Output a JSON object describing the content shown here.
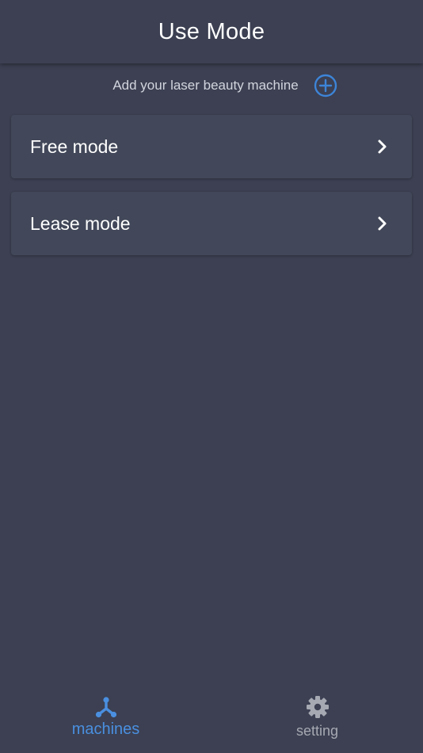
{
  "header": {
    "title": "Use Mode"
  },
  "add_machine": {
    "label": "Add your laser beauty machine",
    "icon": "plus-circle-icon"
  },
  "modes": [
    {
      "label": "Free mode",
      "icon": "chevron-right-icon"
    },
    {
      "label": "Lease mode",
      "icon": "chevron-right-icon"
    }
  ],
  "tabbar": {
    "tabs": [
      {
        "label": "machines",
        "icon": "network-nodes-icon",
        "active": true
      },
      {
        "label": "setting",
        "icon": "gear-icon",
        "active": false
      }
    ]
  },
  "colors": {
    "background": "#3c4052",
    "card": "#424859",
    "accent": "#4a8fe0",
    "inactive": "#a6a9b2"
  }
}
